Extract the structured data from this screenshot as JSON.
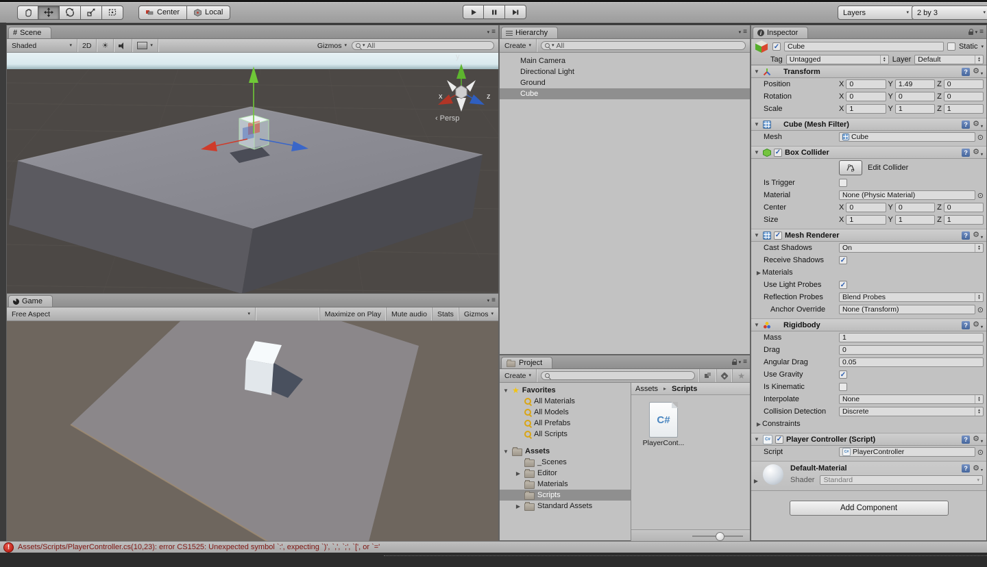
{
  "toolbar": {
    "center": "Center",
    "local": "Local",
    "layers": "Layers",
    "layout": "2 by 3"
  },
  "scene": {
    "tab": "Scene",
    "shaded": "Shaded",
    "d2": "2D",
    "gizmos": "Gizmos",
    "search": "All",
    "persp": "Persp",
    "axis_x": "x",
    "axis_y": "y",
    "axis_z": "z"
  },
  "game": {
    "tab": "Game",
    "aspect": "Free Aspect",
    "maximize": "Maximize on Play",
    "mute": "Mute audio",
    "stats": "Stats",
    "gizmos": "Gizmos"
  },
  "hierarchy": {
    "tab": "Hierarchy",
    "create": "Create",
    "search": "All",
    "items": [
      "Main Camera",
      "Directional Light",
      "Ground",
      "Cube"
    ],
    "selected_item": "Cube"
  },
  "project": {
    "tab": "Project",
    "create": "Create",
    "favorites_label": "Favorites",
    "fav_items": [
      "All Materials",
      "All Models",
      "All Prefabs",
      "All Scripts"
    ],
    "assets_label": "Assets",
    "folders": [
      "_Scenes",
      "Editor",
      "Materials",
      "Scripts",
      "Standard Assets"
    ],
    "selected_folder": "Scripts",
    "crumb_root": "Assets",
    "crumb_current": "Scripts",
    "file_type": "C#",
    "file_label": "PlayerCont..."
  },
  "inspector": {
    "tab": "Inspector",
    "name": "Cube",
    "static_label": "Static",
    "tag_label": "Tag",
    "tag_value": "Untagged",
    "layer_label": "Layer",
    "layer_value": "Default",
    "axes": {
      "x": "X",
      "y": "Y",
      "z": "Z"
    },
    "transform": {
      "title": "Transform",
      "position": {
        "label": "Position",
        "x": "0",
        "y": "1.49",
        "z": "0"
      },
      "rotation": {
        "label": "Rotation",
        "x": "0",
        "y": "0",
        "z": "0"
      },
      "scale": {
        "label": "Scale",
        "x": "1",
        "y": "1",
        "z": "1"
      }
    },
    "mesh_filter": {
      "title": "Cube (Mesh Filter)",
      "mesh_label": "Mesh",
      "mesh_value": "Cube"
    },
    "box_collider": {
      "title": "Box Collider",
      "edit_label": "Edit Collider",
      "trigger_label": "Is Trigger",
      "material_label": "Material",
      "material_value": "None (Physic Material)",
      "center_label": "Center",
      "center": {
        "x": "0",
        "y": "0",
        "z": "0"
      },
      "size_label": "Size",
      "size": {
        "x": "1",
        "y": "1",
        "z": "1"
      }
    },
    "mesh_renderer": {
      "title": "Mesh Renderer",
      "cast_label": "Cast Shadows",
      "cast_value": "On",
      "receive_label": "Receive Shadows",
      "materials_label": "Materials",
      "probes_label": "Use Light Probes",
      "reflection_label": "Reflection Probes",
      "reflection_value": "Blend Probes",
      "anchor_label": "Anchor Override",
      "anchor_value": "None (Transform)"
    },
    "rigidbody": {
      "title": "Rigidbody",
      "mass_label": "Mass",
      "mass_value": "1",
      "drag_label": "Drag",
      "drag_value": "0",
      "angular_label": "Angular Drag",
      "angular_value": "0.05",
      "gravity_label": "Use Gravity",
      "kinematic_label": "Is Kinematic",
      "interpolate_label": "Interpolate",
      "interpolate_value": "None",
      "collision_label": "Collision Detection",
      "collision_value": "Discrete",
      "constraints_label": "Constraints"
    },
    "script_component": {
      "title": "Player Controller (Script)",
      "script_label": "Script",
      "script_value": "PlayerController"
    },
    "material": {
      "name": "Default-Material",
      "shader_label": "Shader",
      "shader_value": "Standard"
    },
    "add_component": "Add Component"
  },
  "status": {
    "error": "Assets/Scripts/PlayerController.cs(10,23): error CS1525: Unexpected symbol `:', expecting `)', `,', `;', `[', or `='"
  },
  "icons": {
    "menu": "≡",
    "caret": "▾",
    "caret_up": "▴",
    "gear": "⚙",
    "help": "?",
    "picker": "⊙",
    "check": "✓",
    "fold_open": "▼",
    "fold_closed": "▶",
    "star": "★",
    "sun": "☀",
    "hash": "#",
    "info": "i",
    "crumb_sep": "▸",
    "error_mark": "!",
    "lt": "‹",
    "cs": "C#"
  },
  "colors": {
    "axis_x": "#cf3b2a",
    "axis_y": "#6abe30",
    "axis_z": "#3a66c8",
    "error_text": "#7e1410",
    "selection_gray": "#8f8f8f",
    "check_blue": "#2a5db0"
  }
}
